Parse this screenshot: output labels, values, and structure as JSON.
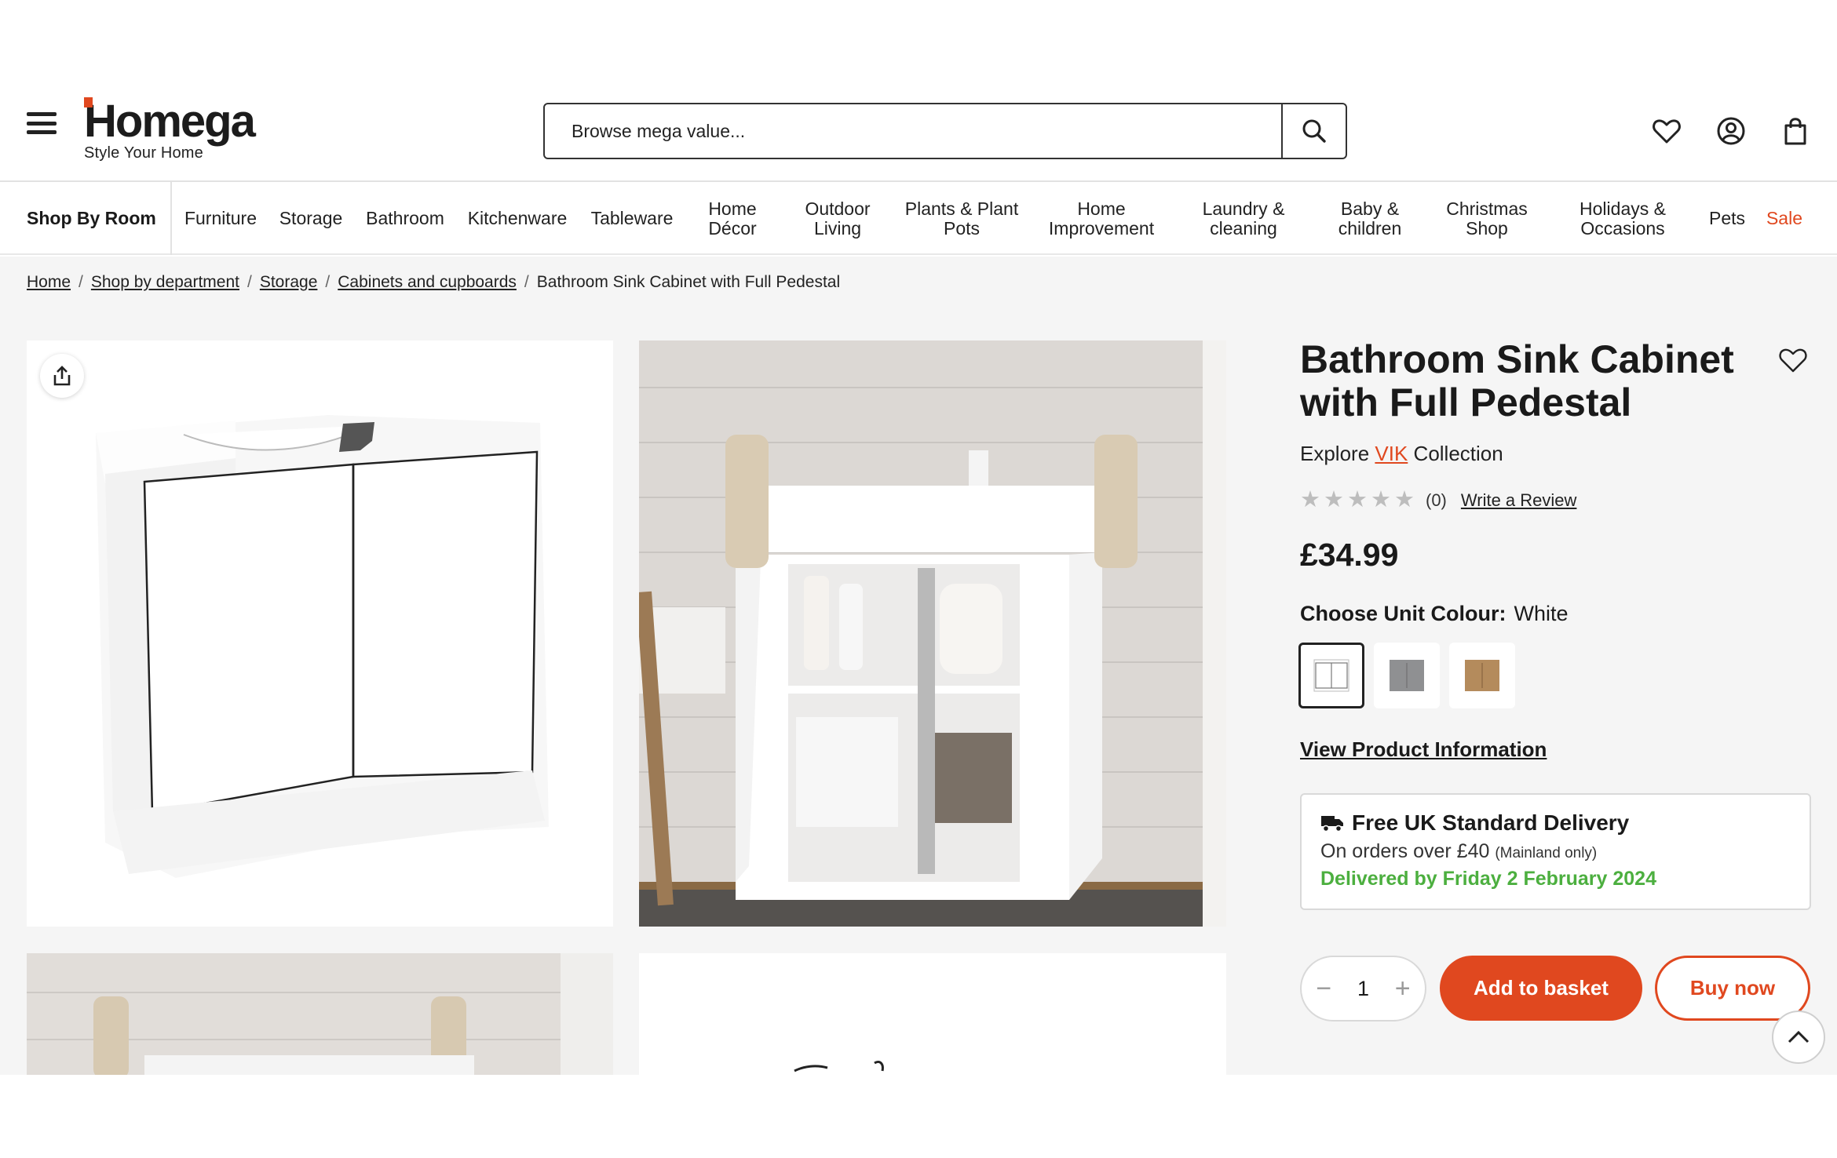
{
  "header": {
    "logo_name": "Homega",
    "logo_tagline": "Style Your Home",
    "search_placeholder": "Browse mega value...",
    "icons": [
      "menu-icon",
      "search-icon",
      "heart-icon",
      "account-icon",
      "basket-icon"
    ]
  },
  "nav": {
    "room_label": "Shop By Room",
    "items": [
      {
        "label": "Furniture"
      },
      {
        "label": "Storage"
      },
      {
        "label": "Bathroom"
      },
      {
        "label": "Kitchenware"
      },
      {
        "label": "Tableware"
      },
      {
        "label": "Home\nDécor"
      },
      {
        "label": "Outdoor\nLiving"
      },
      {
        "label": "Plants & Plant\nPots"
      },
      {
        "label": "Home\nImprovement"
      },
      {
        "label": "Laundry &\ncleaning"
      },
      {
        "label": "Baby &\nchildren"
      },
      {
        "label": "Christmas\nShop"
      },
      {
        "label": "Holidays &\nOccasions"
      },
      {
        "label": "Pets"
      },
      {
        "label": "Sale"
      }
    ]
  },
  "breadcrumb": {
    "links": [
      "Home",
      "Shop by department",
      "Storage",
      "Cabinets and cupboards"
    ],
    "current": "Bathroom Sink Cabinet with Full Pedestal",
    "separator": "/"
  },
  "product": {
    "title": "Bathroom Sink Cabinet with Full Pedestal",
    "explore_prefix": "Explore",
    "collection": "VIK",
    "explore_suffix": "Collection",
    "rating_stars": 0,
    "review_count": "(0)",
    "write_review": "Write a Review",
    "price": "£34.99",
    "colour_label": "Choose Unit Colour:",
    "colour_value": "White",
    "swatches": [
      "White",
      "Grey",
      "Oak"
    ],
    "view_info": "View Product Information",
    "quantity": "1",
    "add_to_basket": "Add to basket",
    "buy_now": "Buy now"
  },
  "delivery": {
    "title": "Free UK Standard Delivery",
    "line": "On orders over £40",
    "note": "(Mainland only)",
    "date": "Delivered by Friday 2 February 2024"
  },
  "colors": {
    "brand_orange": "#e0481f",
    "delivery_green": "#4caf3f"
  }
}
